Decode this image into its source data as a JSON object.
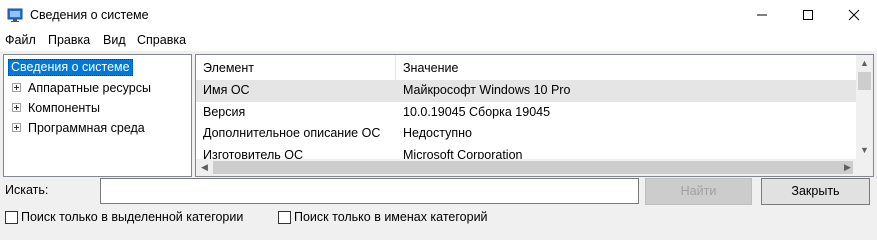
{
  "window": {
    "title": "Сведения о системе",
    "icon": "system-info-icon"
  },
  "menu": [
    "Файл",
    "Правка",
    "Вид",
    "Справка"
  ],
  "tree": {
    "root": "Сведения о системе",
    "children": [
      "Аппаратные ресурсы",
      "Компоненты",
      "Программная среда"
    ]
  },
  "list": {
    "columns": [
      "Элемент",
      "Значение"
    ],
    "rows": [
      {
        "item": "Имя ОС",
        "value": "Майкрософт Windows 10 Pro"
      },
      {
        "item": "Версия",
        "value": "10.0.19045 Сборка 19045"
      },
      {
        "item": "Дополнительное описание ОС",
        "value": "Недоступно"
      },
      {
        "item": "Изготовитель ОС",
        "value": "Microsoft Corporation"
      }
    ],
    "selected_row": 0
  },
  "search": {
    "label": "Искать:",
    "value": "",
    "find_button": "Найти",
    "close_button": "Закрыть"
  },
  "options": {
    "selected_category_only": "Поиск только в выделенной категории",
    "category_names_only": "Поиск только в именах категорий"
  },
  "colors": {
    "selection": "#0078d7",
    "row_highlight": "#e5e5e5"
  }
}
